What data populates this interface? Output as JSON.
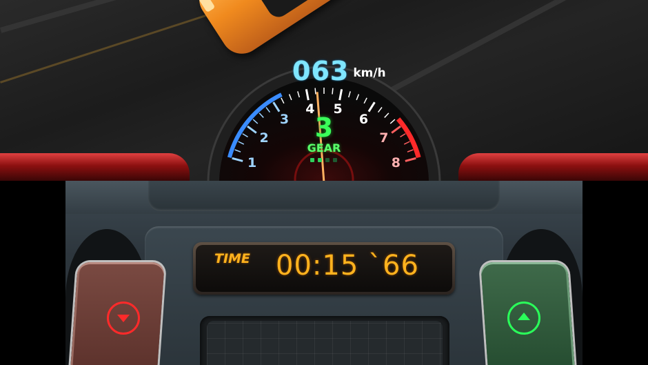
{
  "hud": {
    "speed": "063",
    "speed_unit": "km/h",
    "gear": "3",
    "gear_label": "GEAR",
    "tach_labels": [
      "1",
      "2",
      "3",
      "4",
      "5",
      "6",
      "7",
      "8"
    ],
    "tach_needle_rpm": 4.3,
    "gear_indicator": {
      "lit": 2,
      "total": 4
    }
  },
  "timer": {
    "label": "TIME",
    "value": "00:15 `66"
  },
  "controls": {
    "downshift_icon": "chevron-down-circle-icon",
    "upshift_icon": "chevron-up-circle-icon"
  },
  "colors": {
    "speed": "#7fe6ff",
    "gear": "#3aff5a",
    "timer": "#ffb21e",
    "downshift": "#ff2a2a",
    "upshift": "#2aff5a",
    "car": "#f08a1e"
  }
}
